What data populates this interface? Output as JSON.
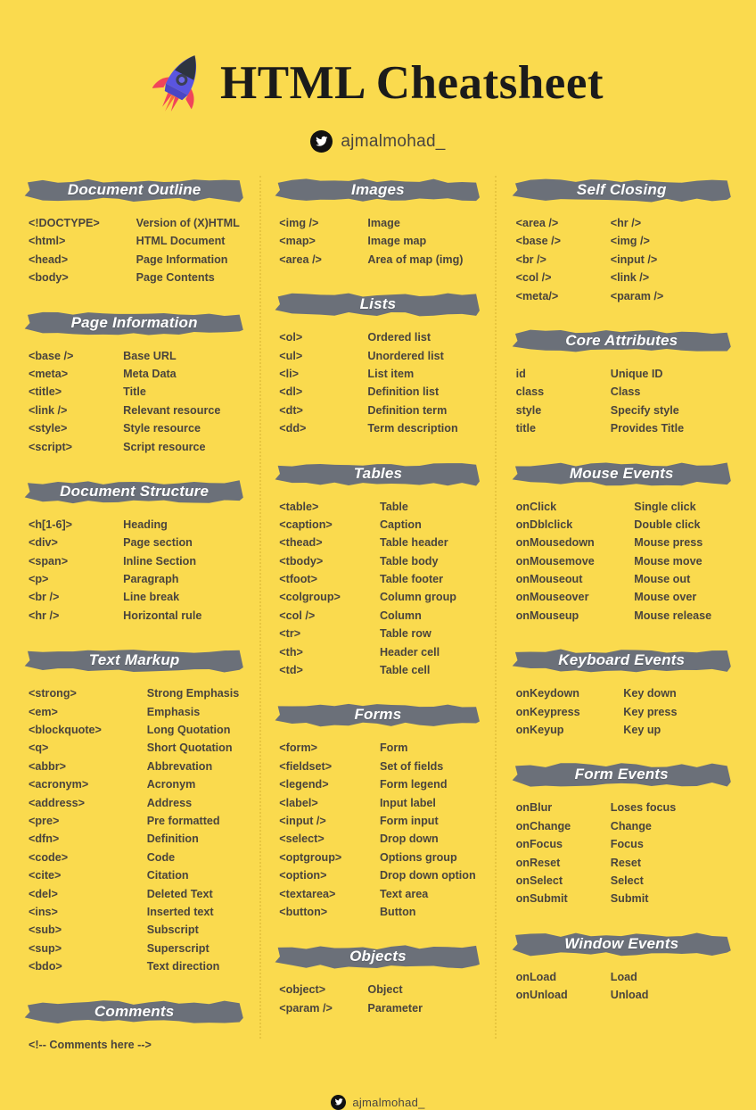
{
  "header": {
    "title": "HTML Cheatsheet",
    "handle": "ajmalmohad_",
    "rocket_icon": "rocket-icon",
    "twitter_icon": "twitter-icon"
  },
  "footer": {
    "handle": "ajmalmohad_",
    "twitter_icon": "twitter-icon"
  },
  "colors": {
    "background": "#fada4e",
    "banner": "#6b7079",
    "text": "#4a443d",
    "banner_text": "#ffffff",
    "title": "#1b1b1b",
    "divider": "#e8c63f"
  },
  "columns": [
    {
      "sections": [
        {
          "title": "Document Outline",
          "rows": [
            {
              "tag": "<!DOCTYPE>",
              "desc": "Version of (X)HTML"
            },
            {
              "tag": "<html>",
              "desc": "HTML Document"
            },
            {
              "tag": "<head>",
              "desc": "Page Information"
            },
            {
              "tag": "<body>",
              "desc": "Page Contents"
            }
          ]
        },
        {
          "title": "Page Information",
          "rows": [
            {
              "tag": "<base />",
              "desc": "Base URL"
            },
            {
              "tag": "<meta>",
              "desc": "Meta Data"
            },
            {
              "tag": "<title>",
              "desc": "Title"
            },
            {
              "tag": "<link />",
              "desc": "Relevant resource"
            },
            {
              "tag": "<style>",
              "desc": "Style resource"
            },
            {
              "tag": "<script>",
              "desc": "Script resource"
            }
          ]
        },
        {
          "title": "Document Structure",
          "rows": [
            {
              "tag": "<h[1-6]>",
              "desc": "Heading"
            },
            {
              "tag": "<div>",
              "desc": "Page section"
            },
            {
              "tag": "<span>",
              "desc": "Inline Section"
            },
            {
              "tag": "<p>",
              "desc": "Paragraph"
            },
            {
              "tag": "<br />",
              "desc": "Line break"
            },
            {
              "tag": "<hr />",
              "desc": "Horizontal rule"
            }
          ]
        },
        {
          "title": "Text Markup",
          "rows": [
            {
              "tag": "<strong>",
              "desc": "Strong Emphasis"
            },
            {
              "tag": "<em>",
              "desc": "Emphasis"
            },
            {
              "tag": "<blockquote>",
              "desc": "Long Quotation"
            },
            {
              "tag": "<q>",
              "desc": "Short Quotation"
            },
            {
              "tag": "<abbr>",
              "desc": "Abbrevation"
            },
            {
              "tag": "<acronym>",
              "desc": "Acronym"
            },
            {
              "tag": "<address>",
              "desc": "Address"
            },
            {
              "tag": "<pre>",
              "desc": "Pre formatted"
            },
            {
              "tag": "<dfn>",
              "desc": "Definition"
            },
            {
              "tag": "<code>",
              "desc": "Code"
            },
            {
              "tag": "<cite>",
              "desc": "Citation"
            },
            {
              "tag": "<del>",
              "desc": "Deleted Text"
            },
            {
              "tag": "<ins>",
              "desc": "Inserted text"
            },
            {
              "tag": "<sub>",
              "desc": "Subscript"
            },
            {
              "tag": "<sup>",
              "desc": "Superscript"
            },
            {
              "tag": "<bdo>",
              "desc": "Text direction"
            }
          ]
        },
        {
          "title": "Comments",
          "single_rows": [
            "<!-- Comments here -->"
          ]
        }
      ]
    },
    {
      "sections": [
        {
          "title": "Images",
          "rows": [
            {
              "tag": "<img />",
              "desc": "Image"
            },
            {
              "tag": "<map>",
              "desc": "Image map"
            },
            {
              "tag": "<area />",
              "desc": "Area of map (img)"
            }
          ]
        },
        {
          "title": "Lists",
          "rows": [
            {
              "tag": "<ol>",
              "desc": "Ordered list"
            },
            {
              "tag": "<ul>",
              "desc": "Unordered list"
            },
            {
              "tag": "<li>",
              "desc": "List item"
            },
            {
              "tag": "<dl>",
              "desc": "Definition list"
            },
            {
              "tag": "<dt>",
              "desc": "Definition term"
            },
            {
              "tag": "<dd>",
              "desc": "Term description"
            }
          ]
        },
        {
          "title": "Tables",
          "rows": [
            {
              "tag": "<table>",
              "desc": "Table"
            },
            {
              "tag": "<caption>",
              "desc": "Caption"
            },
            {
              "tag": "<thead>",
              "desc": "Table header"
            },
            {
              "tag": "<tbody>",
              "desc": "Table body"
            },
            {
              "tag": "<tfoot>",
              "desc": "Table footer"
            },
            {
              "tag": "<colgroup>",
              "desc": "Column group"
            },
            {
              "tag": "<col />",
              "desc": "Column"
            },
            {
              "tag": "<tr>",
              "desc": "Table row"
            },
            {
              "tag": "<th>",
              "desc": "Header cell"
            },
            {
              "tag": "<td>",
              "desc": "Table cell"
            }
          ]
        },
        {
          "title": "Forms",
          "rows": [
            {
              "tag": "<form>",
              "desc": "Form"
            },
            {
              "tag": "<fieldset>",
              "desc": "Set of fields"
            },
            {
              "tag": "<legend>",
              "desc": "Form legend"
            },
            {
              "tag": "<label>",
              "desc": "Input label"
            },
            {
              "tag": "<input />",
              "desc": "Form input"
            },
            {
              "tag": "<select>",
              "desc": "Drop down"
            },
            {
              "tag": "<optgroup>",
              "desc": "Options group"
            },
            {
              "tag": "<option>",
              "desc": "Drop down option"
            },
            {
              "tag": "<textarea>",
              "desc": "Text area"
            },
            {
              "tag": "<button>",
              "desc": "Button"
            }
          ]
        },
        {
          "title": "Objects",
          "rows": [
            {
              "tag": "<object>",
              "desc": "Object"
            },
            {
              "tag": "<param />",
              "desc": "Parameter"
            }
          ]
        }
      ]
    },
    {
      "sections": [
        {
          "title": "Self Closing",
          "rows": [
            {
              "tag": "<area />",
              "desc": "<hr />"
            },
            {
              "tag": "<base />",
              "desc": "<img />"
            },
            {
              "tag": "<br />",
              "desc": "<input />"
            },
            {
              "tag": "<col />",
              "desc": "<link />"
            },
            {
              "tag": "<meta/>",
              "desc": "<param />"
            }
          ]
        },
        {
          "title": "Core Attributes",
          "rows": [
            {
              "tag": "id",
              "desc": "Unique ID"
            },
            {
              "tag": "class",
              "desc": "Class"
            },
            {
              "tag": "style",
              "desc": "Specify style"
            },
            {
              "tag": "title",
              "desc": "Provides Title"
            }
          ]
        },
        {
          "title": "Mouse Events",
          "rows": [
            {
              "tag": "onClick",
              "desc": "Single click"
            },
            {
              "tag": "onDblclick",
              "desc": "Double click"
            },
            {
              "tag": "onMousedown",
              "desc": "Mouse press"
            },
            {
              "tag": "onMousemove",
              "desc": "Mouse move"
            },
            {
              "tag": "onMouseout",
              "desc": "Mouse out"
            },
            {
              "tag": "onMouseover",
              "desc": "Mouse over"
            },
            {
              "tag": "onMouseup",
              "desc": "Mouse release"
            }
          ]
        },
        {
          "title": "Keyboard Events",
          "rows": [
            {
              "tag": "onKeydown",
              "desc": "Key down"
            },
            {
              "tag": "onKeypress",
              "desc": "Key press"
            },
            {
              "tag": "onKeyup",
              "desc": "Key up"
            }
          ]
        },
        {
          "title": "Form Events",
          "rows": [
            {
              "tag": "onBlur",
              "desc": "Loses focus"
            },
            {
              "tag": "onChange",
              "desc": "Change"
            },
            {
              "tag": "onFocus",
              "desc": "Focus"
            },
            {
              "tag": "onReset",
              "desc": "Reset"
            },
            {
              "tag": "onSelect",
              "desc": "Select"
            },
            {
              "tag": "onSubmit",
              "desc": "Submit"
            }
          ]
        },
        {
          "title": "Window Events",
          "rows": [
            {
              "tag": "onLoad",
              "desc": "Load"
            },
            {
              "tag": "onUnload",
              "desc": "Unload"
            }
          ]
        }
      ]
    }
  ]
}
